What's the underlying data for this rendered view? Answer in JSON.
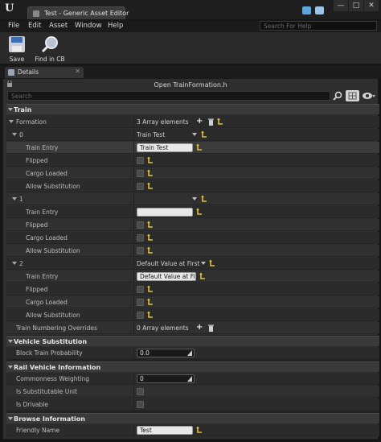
{
  "window": {
    "tab_title": "Test - Generic Asset Editor",
    "minimize": "—",
    "maximize": "□",
    "close": "✕"
  },
  "menu": {
    "items": [
      "File",
      "Edit",
      "Asset",
      "Window",
      "Help"
    ],
    "help_search_placeholder": "Search For Help"
  },
  "toolbar": {
    "save_label": "Save",
    "find_label": "Find in CB"
  },
  "details": {
    "tab_label": "Details",
    "file_title": "Open TrainFormation.h",
    "search_placeholder": "Search"
  },
  "categories": {
    "train": "Train",
    "vehicle_substitution": "Vehicle Substitution",
    "rail_vehicle_info": "Rail Vehicle Information",
    "browse_info": "Browse Information"
  },
  "train": {
    "formation_label": "Formation",
    "formation_value": "3 Array elements",
    "elements": [
      {
        "index": "0",
        "combo_value": "Train Test",
        "train_entry_label": "Train Entry",
        "train_entry_value": "Train Test",
        "flipped_label": "Flipped",
        "cargo_label": "Cargo Loaded",
        "allow_label": "Allow Substitution"
      },
      {
        "index": "1",
        "combo_value": "",
        "train_entry_label": "Train Entry",
        "train_entry_value": "",
        "flipped_label": "Flipped",
        "cargo_label": "Cargo Loaded",
        "allow_label": "Allow Substitution"
      },
      {
        "index": "2",
        "combo_value": "Default Value at First",
        "train_entry_label": "Train Entry",
        "train_entry_value": "Default Value at First",
        "flipped_label": "Flipped",
        "cargo_label": "Cargo Loaded",
        "allow_label": "Allow Substitution"
      }
    ],
    "overrides_label": "Train Numbering Overrides",
    "overrides_value": "0 Array elements"
  },
  "vehicle_substitution": {
    "block_label": "Block Train Probability",
    "block_value": "0.0"
  },
  "rail_vehicle": {
    "commonness_label": "Commonness Weighting",
    "commonness_value": "0",
    "substitutable_label": "Is Substitutable Unit",
    "drivable_label": "Is Drivable"
  },
  "browse": {
    "friendly_label": "Friendly Name",
    "friendly_value": "Test"
  },
  "colors": {
    "accent_yellow": "#e6c229",
    "panel_bg": "#2e2e2e",
    "category_bg": "#3a3a3a"
  }
}
